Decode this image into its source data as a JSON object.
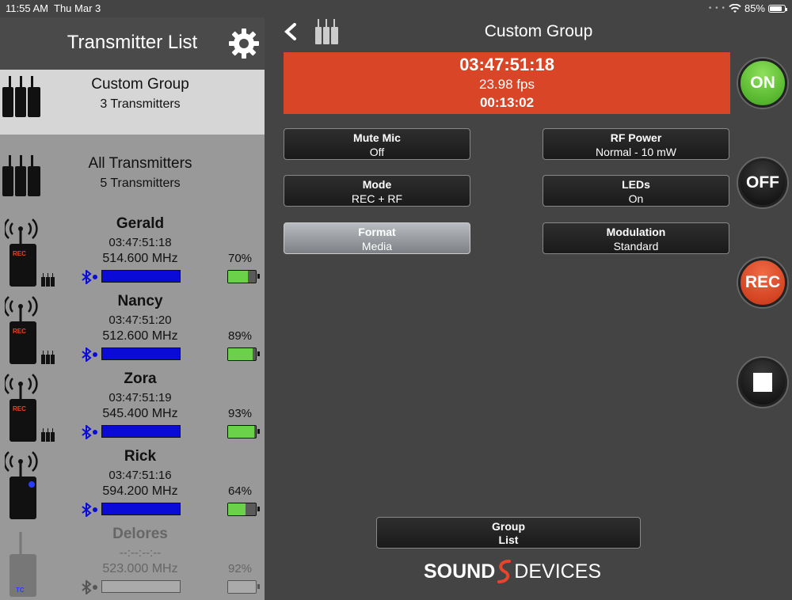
{
  "status": {
    "time": "11:55 AM",
    "date": "Thu Mar 3",
    "battery": "85%",
    "battery_level": 0.85
  },
  "sidebar": {
    "title": "Transmitter List",
    "groups": [
      {
        "name": "Custom Group",
        "count": "3 Transmitters",
        "selected": true
      },
      {
        "name": "All Transmitters",
        "count": "5 Transmitters",
        "selected": false
      }
    ],
    "transmitters": [
      {
        "name": "Gerald",
        "timecode": "03:47:51:18",
        "frequency": "514.600 MHz",
        "battery": "70%",
        "battery_level": 0.7,
        "status": "REC",
        "active": true
      },
      {
        "name": "Nancy",
        "timecode": "03:47:51:20",
        "frequency": "512.600 MHz",
        "battery": "89%",
        "battery_level": 0.89,
        "status": "REC",
        "active": true
      },
      {
        "name": "Zora",
        "timecode": "03:47:51:19",
        "frequency": "545.400 MHz",
        "battery": "93%",
        "battery_level": 0.93,
        "status": "REC",
        "active": true
      },
      {
        "name": "Rick",
        "timecode": "03:47:51:16",
        "frequency": "594.200 MHz",
        "battery": "64%",
        "battery_level": 0.64,
        "status": "",
        "active": true
      },
      {
        "name": "Delores",
        "timecode": "--:--:--:--",
        "frequency": "523.000 MHz",
        "battery": "92%",
        "battery_level": 0.92,
        "status": "TC",
        "active": false
      }
    ]
  },
  "main": {
    "title": "Custom Group",
    "timecode": "03:47:51:18",
    "fps": "23.98 fps",
    "elapsed": "00:13:02",
    "settings": [
      {
        "label": "Mute Mic",
        "value": "Off",
        "active": false
      },
      {
        "label": "RF Power",
        "value": "Normal - 10 mW",
        "active": false
      },
      {
        "label": "Mode",
        "value": "REC + RF",
        "active": false
      },
      {
        "label": "LEDs",
        "value": "On",
        "active": false
      },
      {
        "label": "Format",
        "value": "Media",
        "active": true
      },
      {
        "label": "Modulation",
        "value": "Standard",
        "active": false
      }
    ],
    "buttons": {
      "on": "ON",
      "off": "OFF",
      "rec": "REC"
    },
    "group_list": {
      "line1": "Group",
      "line2": "List"
    },
    "logo": {
      "part1": "SOUND",
      "part2": "DEVICES"
    }
  },
  "colors": {
    "accent_red": "#d94527",
    "on_green": "#5cc02e",
    "rf_blue": "#0b0bd8",
    "battery_green": "#6bd14a"
  }
}
